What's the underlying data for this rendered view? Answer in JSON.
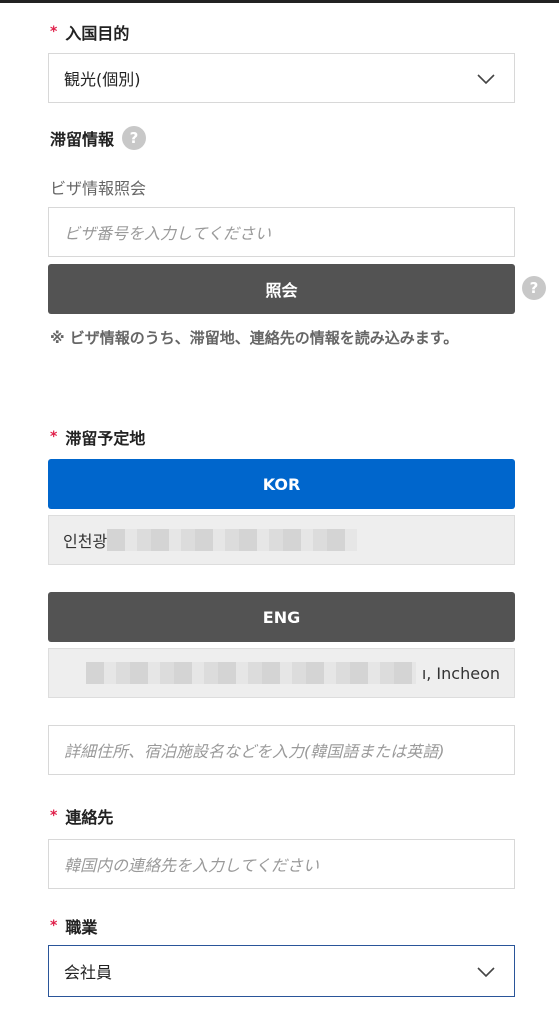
{
  "purpose": {
    "label": "入国目的",
    "selected": "観光(個別)"
  },
  "stay_info": {
    "title": "滞留情報",
    "help_icon": "question-icon"
  },
  "visa": {
    "label": "ビザ情報照会",
    "placeholder": "ビザ番号を入力してください",
    "button": "照会",
    "note": "※ ビザ情報のうち、滞留地、連絡先の情報を読み込みます。"
  },
  "address": {
    "label": "滞留予定地",
    "kor_button": "KOR",
    "kor_value_visible": "인천광",
    "eng_button": "ENG",
    "eng_value_visible": "ı, Incheon",
    "detail_placeholder": "詳細住所、宿泊施設名などを入力(韓国語または英語)"
  },
  "contact": {
    "label": "連絡先",
    "placeholder": "韓国内の連絡先を入力してください"
  },
  "job": {
    "label": "職業",
    "selected": "会社員"
  },
  "colors": {
    "accent": "#0066cc",
    "required": "#e0204a",
    "dark_button": "#535353"
  }
}
